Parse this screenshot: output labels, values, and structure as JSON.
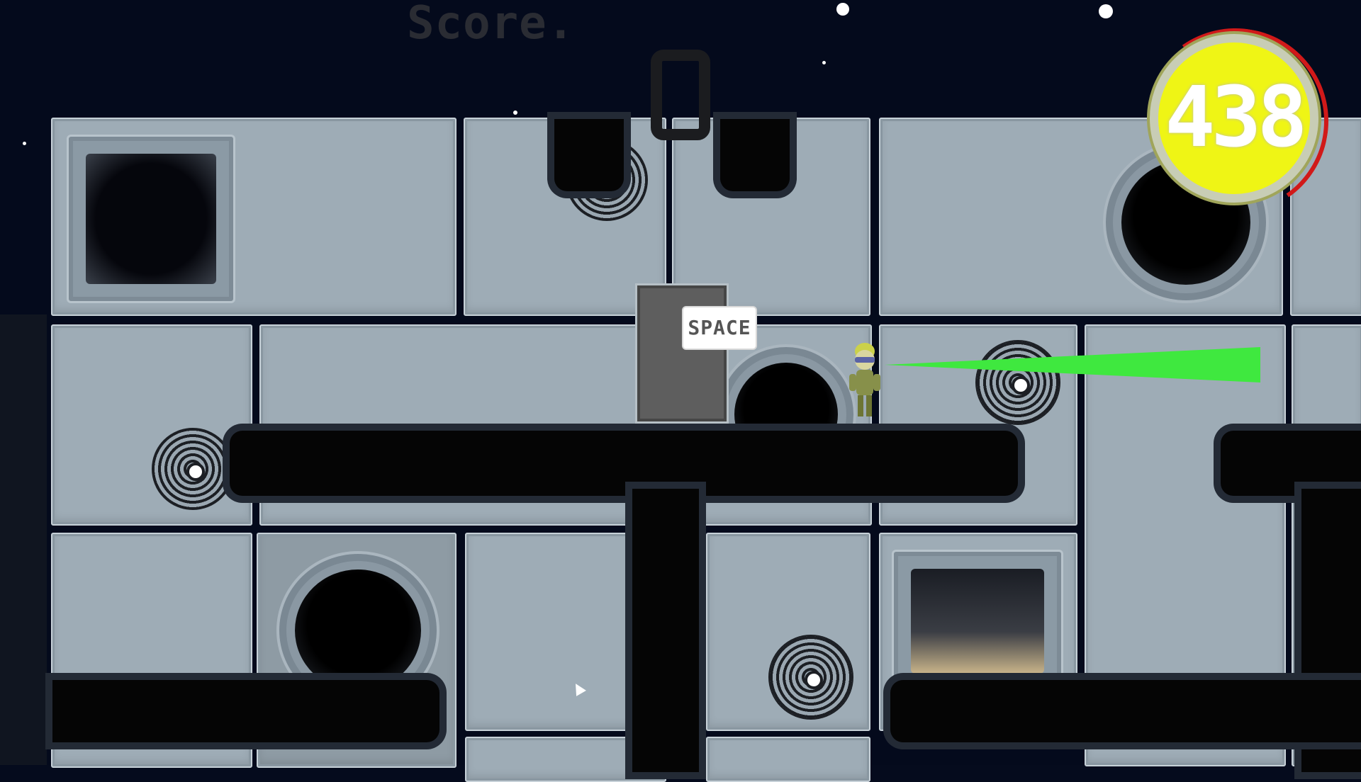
{
  "hud": {
    "score_label": "Score.",
    "score_value": "0",
    "timer_value": "438"
  },
  "prompt": {
    "key_label": "SPACE"
  },
  "colors": {
    "sky": "#040a1c",
    "panel": "#9eacb6",
    "timer_fill": "#eff515",
    "timer_ring": "#d11919",
    "laser": "#3fe83f",
    "pipe": "#050505"
  },
  "icons": {
    "player": "astronaut-character-icon",
    "cursor": "mouse-cursor-icon",
    "vent": "vent-icon",
    "porthole": "porthole-window-icon"
  }
}
